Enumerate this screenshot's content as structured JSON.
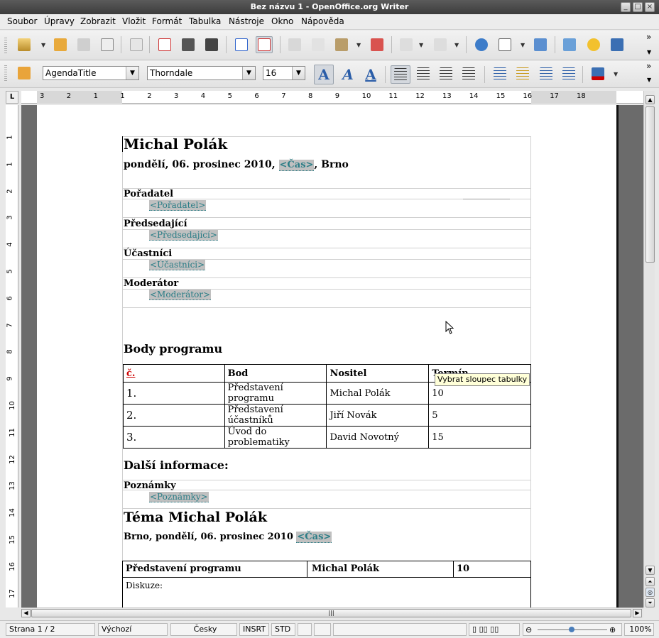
{
  "window": {
    "title": "Bez názvu 1 - OpenOffice.org Writer"
  },
  "menu": [
    "Soubor",
    "Úpravy",
    "Zobrazit",
    "Vložit",
    "Formát",
    "Tabulka",
    "Nástroje",
    "Okno",
    "Nápověda"
  ],
  "format_toolbar": {
    "style": "AgendaTitle",
    "font": "Thorndale",
    "size": "16"
  },
  "ruler": {
    "h_labels": [
      "3",
      "2",
      "1",
      "1",
      "2",
      "3",
      "4",
      "5",
      "6",
      "7",
      "8",
      "9",
      "10",
      "11",
      "12",
      "13",
      "14",
      "15",
      "16",
      "17",
      "18"
    ],
    "v_labels": [
      "1",
      "1",
      "2",
      "3",
      "4",
      "5",
      "6",
      "7",
      "8",
      "9",
      "10",
      "11",
      "12",
      "13",
      "14",
      "15",
      "16",
      "17"
    ]
  },
  "document": {
    "heading": "Michal Polák",
    "date_prefix": "pondělí, 06. prosinec 2010, ",
    "time_field": "<Čas>",
    "date_suffix": ", Brno",
    "sections": [
      {
        "label": "Pořadatel",
        "field": "<Pořadatel>"
      },
      {
        "label": "Předsedající",
        "field": "<Předsedající>"
      },
      {
        "label": "Účastníci",
        "field": "<Účastníci>"
      },
      {
        "label": "Moderátor",
        "field": "<Moderátor>"
      }
    ],
    "body_heading": "Body programu",
    "table": {
      "headers": [
        "č.",
        "Bod",
        "Nositel",
        "Termín"
      ],
      "rows": [
        [
          "1.",
          "Představení programu",
          "Michal Polák",
          "10"
        ],
        [
          "2.",
          "Představení účastníků",
          "Jiří Novák",
          "5"
        ],
        [
          "3.",
          "Úvod do problematiky",
          "David Novotný",
          "15"
        ]
      ]
    },
    "more_info_heading": "Další informace:",
    "notes_label": "Poznámky",
    "notes_field": "<Poznámky>",
    "topic_heading": "Téma Michal Polák",
    "topic_sub": "Brno, pondělí, 06. prosinec 2010 ",
    "topic_time_field": "<Čas>",
    "topic_table": {
      "cells": [
        "Představení programu",
        "Michal Polák",
        "10"
      ],
      "discussion": "Diskuze:"
    }
  },
  "tooltip": "Vybrat sloupec tabulky",
  "status": {
    "page": "Strana 1 / 2",
    "style": "Výchozí",
    "language": "Česky",
    "insert": "INSRT",
    "selection": "STD",
    "zoom": "100%"
  },
  "colors": {
    "field_bg": "#c0c0c0",
    "field_text": "#2b7d86",
    "titlebar": "#4a4a4a"
  }
}
